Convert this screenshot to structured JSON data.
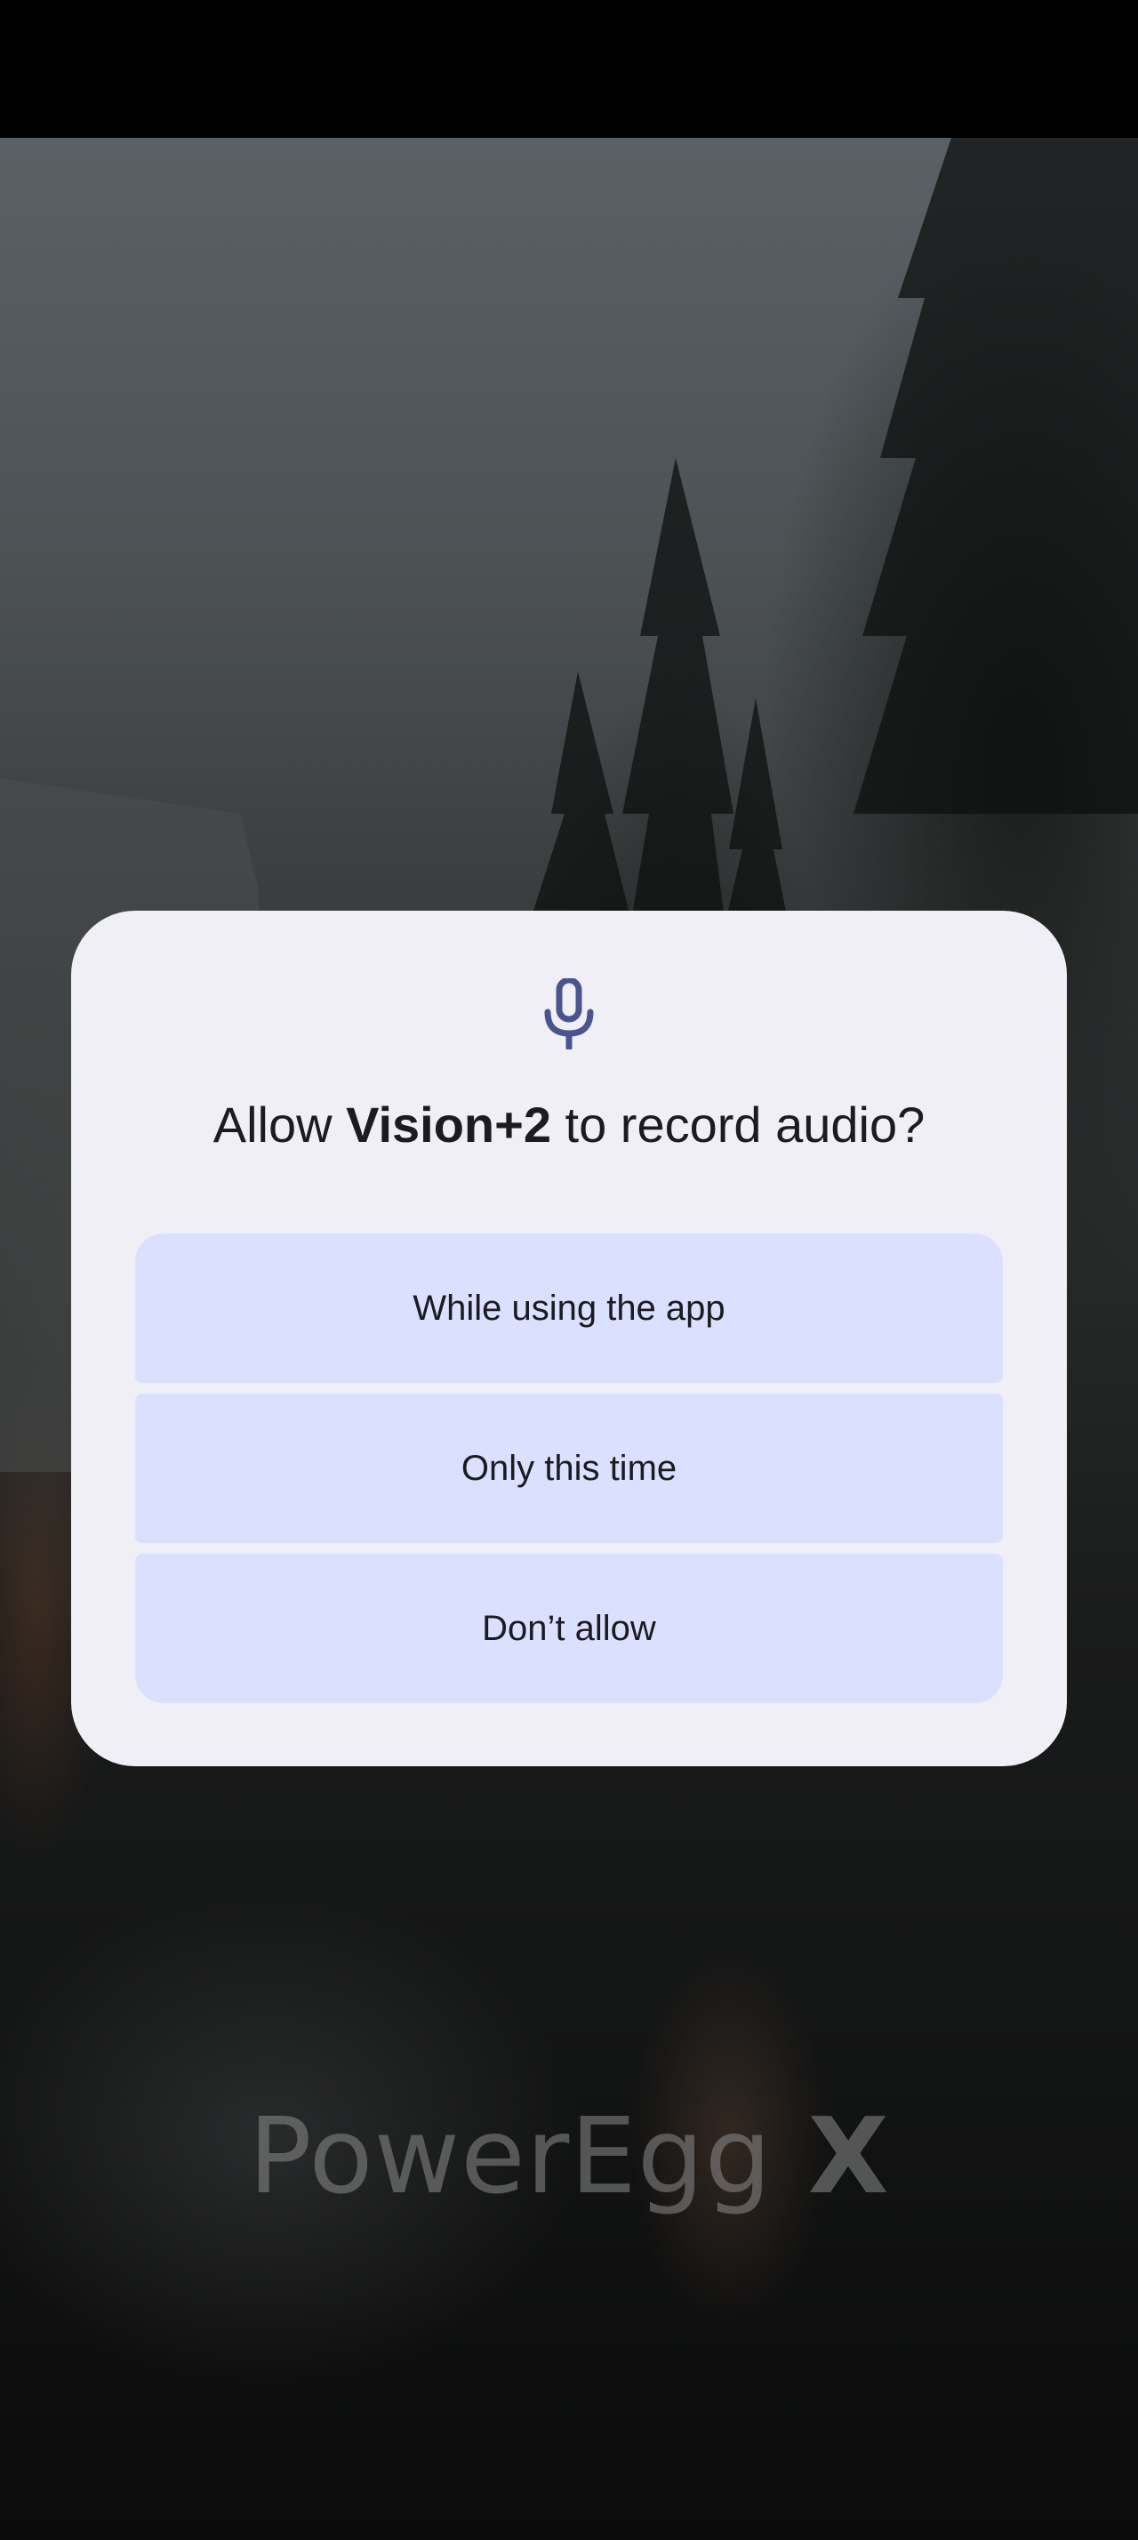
{
  "background": {
    "brand_logo": {
      "word": "PowerEgg",
      "mark": "X"
    }
  },
  "dialog": {
    "icon": "microphone-icon",
    "title_prefix": "Allow ",
    "app_name": "Vision+2",
    "title_suffix": " to record audio?",
    "buttons": {
      "while_using": "While using the app",
      "only_this_time": "Only this time",
      "dont_allow": "Don’t allow"
    }
  },
  "colors": {
    "dialog_bg": "#f0eff5",
    "button_bg": "#dae0fd",
    "icon_color": "#4a5590",
    "text_color": "#1c1b20"
  }
}
